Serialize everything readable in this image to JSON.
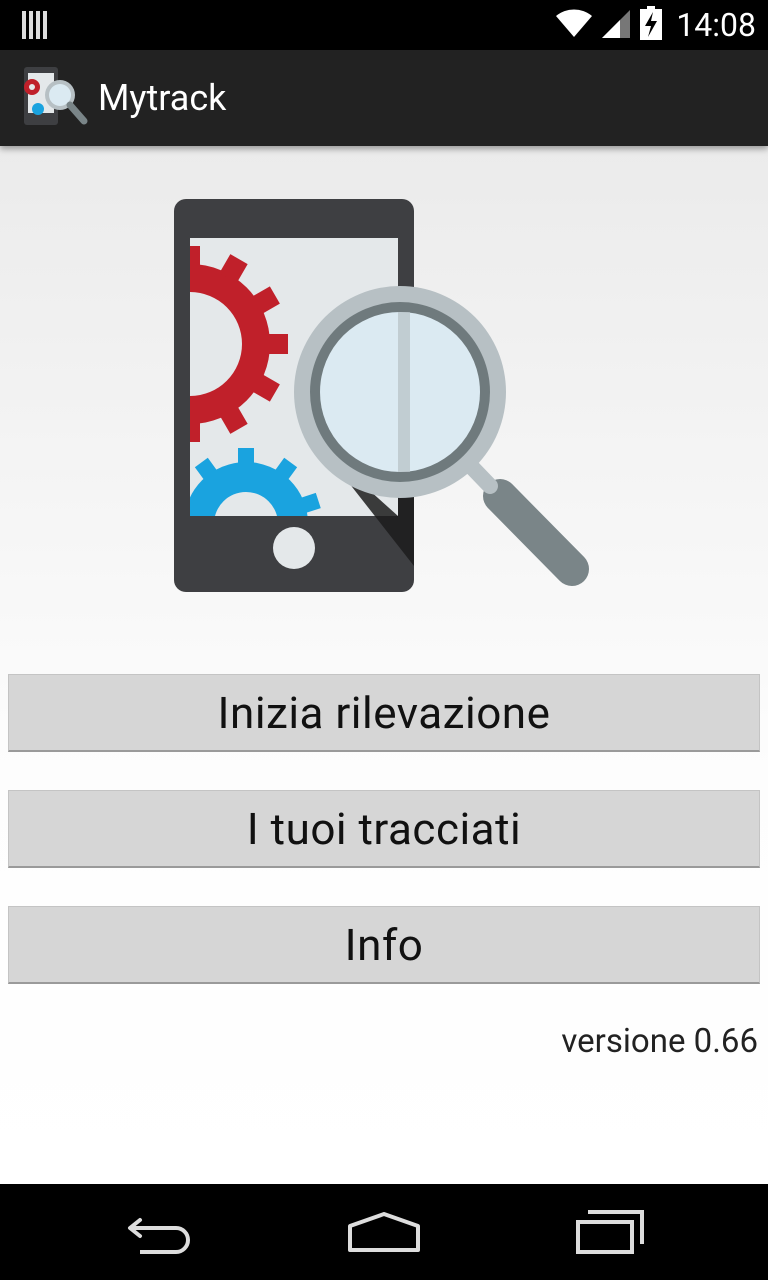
{
  "app": {
    "title": "Mytrack"
  },
  "status_bar": {
    "time": "14:08",
    "icons": [
      "notification-bars-icon",
      "wifi-icon",
      "signal-icon",
      "battery-charging-icon"
    ]
  },
  "buttons": {
    "start": "Inizia rilevazione",
    "tracks": "I tuoi tracciati",
    "info": "Info"
  },
  "version": "versione 0.66",
  "nav": {
    "icons": [
      "back-icon",
      "home-icon",
      "recent-apps-icon"
    ]
  },
  "colors": {
    "action_bar": "#222222",
    "button": "#d6d6d6",
    "gear_red": "#c0202a",
    "gear_blue": "#1aa3df"
  }
}
